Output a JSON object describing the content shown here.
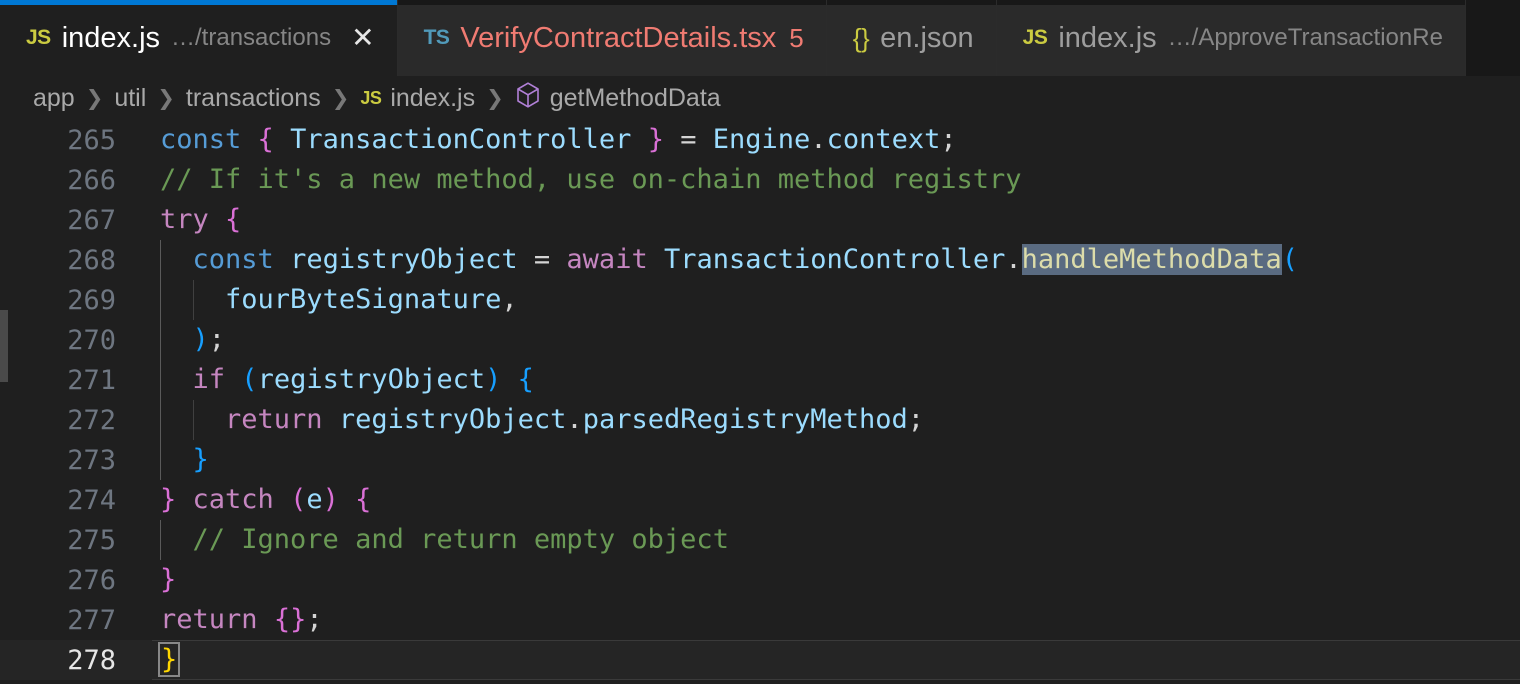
{
  "window": {
    "app": "Visual Studio Code",
    "accent_color": "#0078d4",
    "editor_background": "#1f1f1f",
    "tabbar_background": "#181818"
  },
  "tabbar": {
    "tabs": [
      {
        "icon": "js-file-icon",
        "icon_label": "JS",
        "name": "index.js",
        "path": "…/transactions",
        "badge": "",
        "close_label": "✕",
        "active": true,
        "has_errors": false
      },
      {
        "icon": "ts-file-icon",
        "icon_label": "TS",
        "name": "VerifyContractDetails.tsx",
        "path": "",
        "badge": "5",
        "close_label": "",
        "active": false,
        "has_errors": true
      },
      {
        "icon": "json-file-icon",
        "icon_label": "{}",
        "name": "en.json",
        "path": "",
        "badge": "",
        "close_label": "",
        "active": false,
        "has_errors": false
      },
      {
        "icon": "js-file-icon",
        "icon_label": "JS",
        "name": "index.js",
        "path": "…/ApproveTransactionRe",
        "badge": "",
        "close_label": "",
        "active": false,
        "has_errors": false
      }
    ]
  },
  "breadcrumb": {
    "separator": "❯",
    "items": [
      {
        "label": "app",
        "icon": ""
      },
      {
        "label": "util",
        "icon": ""
      },
      {
        "label": "transactions",
        "icon": ""
      },
      {
        "label": "index.js",
        "icon": "js-file-icon",
        "icon_label": "JS"
      },
      {
        "label": "getMethodData",
        "icon": "symbol-method-icon"
      }
    ]
  },
  "editor": {
    "language": "javascript",
    "active_line": 278,
    "selected_word": "handleMethodData",
    "first_visible_line": 265,
    "last_visible_line": 278,
    "lines": [
      {
        "n": "265",
        "text": "const { TransactionController } = Engine.context;"
      },
      {
        "n": "266",
        "text": "// If it's a new method, use on-chain method registry"
      },
      {
        "n": "267",
        "text": "try {"
      },
      {
        "n": "268",
        "text": "  const registryObject = await TransactionController.handleMethodData("
      },
      {
        "n": "269",
        "text": "    fourByteSignature,"
      },
      {
        "n": "270",
        "text": "  );"
      },
      {
        "n": "271",
        "text": "  if (registryObject) {"
      },
      {
        "n": "272",
        "text": "    return registryObject.parsedRegistryMethod;"
      },
      {
        "n": "273",
        "text": "  }"
      },
      {
        "n": "274",
        "text": "} catch (e) {"
      },
      {
        "n": "275",
        "text": "  // Ignore and return empty object"
      },
      {
        "n": "276",
        "text": "}"
      },
      {
        "n": "277",
        "text": "return {};"
      },
      {
        "n": "278",
        "text": "}"
      }
    ],
    "tokens": {
      "l265": [
        {
          "t": "const",
          "c": "kw2"
        },
        {
          "t": " ",
          "c": "pun"
        },
        {
          "t": "{",
          "c": "brc"
        },
        {
          "t": " ",
          "c": "pun"
        },
        {
          "t": "TransactionController",
          "c": "var"
        },
        {
          "t": " ",
          "c": "pun"
        },
        {
          "t": "}",
          "c": "brc"
        },
        {
          "t": " = ",
          "c": "pun"
        },
        {
          "t": "Engine",
          "c": "var"
        },
        {
          "t": ".",
          "c": "pun"
        },
        {
          "t": "context",
          "c": "var"
        },
        {
          "t": ";",
          "c": "pun"
        }
      ],
      "l266": [
        {
          "t": "// If it's a new method, use on-chain method registry",
          "c": "cmt"
        }
      ],
      "l267": [
        {
          "t": "try",
          "c": "kw"
        },
        {
          "t": " ",
          "c": "pun"
        },
        {
          "t": "{",
          "c": "brc"
        }
      ],
      "l268": [
        {
          "t": "  ",
          "c": "pun"
        },
        {
          "t": "const",
          "c": "kw2"
        },
        {
          "t": " ",
          "c": "pun"
        },
        {
          "t": "registryObject",
          "c": "var"
        },
        {
          "t": " = ",
          "c": "pun"
        },
        {
          "t": "await",
          "c": "kw"
        },
        {
          "t": " ",
          "c": "pun"
        },
        {
          "t": "TransactionController",
          "c": "var"
        },
        {
          "t": ".",
          "c": "pun"
        },
        {
          "t": "handleMethodData",
          "c": "fn sel"
        },
        {
          "t": "(",
          "c": "brc2"
        }
      ],
      "l269": [
        {
          "t": "    ",
          "c": "pun"
        },
        {
          "t": "fourByteSignature",
          "c": "var"
        },
        {
          "t": ",",
          "c": "pun"
        }
      ],
      "l270": [
        {
          "t": "  ",
          "c": "pun"
        },
        {
          "t": ")",
          "c": "brc2"
        },
        {
          "t": ";",
          "c": "pun"
        }
      ],
      "l271": [
        {
          "t": "  ",
          "c": "pun"
        },
        {
          "t": "if",
          "c": "kw"
        },
        {
          "t": " ",
          "c": "pun"
        },
        {
          "t": "(",
          "c": "brc2"
        },
        {
          "t": "registryObject",
          "c": "var"
        },
        {
          "t": ")",
          "c": "brc2"
        },
        {
          "t": " ",
          "c": "pun"
        },
        {
          "t": "{",
          "c": "brc2"
        }
      ],
      "l272": [
        {
          "t": "    ",
          "c": "pun"
        },
        {
          "t": "return",
          "c": "kw"
        },
        {
          "t": " ",
          "c": "pun"
        },
        {
          "t": "registryObject",
          "c": "var"
        },
        {
          "t": ".",
          "c": "pun"
        },
        {
          "t": "parsedRegistryMethod",
          "c": "var"
        },
        {
          "t": ";",
          "c": "pun"
        }
      ],
      "l273": [
        {
          "t": "  ",
          "c": "pun"
        },
        {
          "t": "}",
          "c": "brc2"
        }
      ],
      "l274": [
        {
          "t": "}",
          "c": "brc"
        },
        {
          "t": " ",
          "c": "pun"
        },
        {
          "t": "catch",
          "c": "kw"
        },
        {
          "t": " ",
          "c": "pun"
        },
        {
          "t": "(",
          "c": "brc"
        },
        {
          "t": "e",
          "c": "var"
        },
        {
          "t": ")",
          "c": "brc"
        },
        {
          "t": " ",
          "c": "pun"
        },
        {
          "t": "{",
          "c": "brc"
        }
      ],
      "l275": [
        {
          "t": "  ",
          "c": "pun"
        },
        {
          "t": "// Ignore and return empty object",
          "c": "cmt"
        }
      ],
      "l276": [
        {
          "t": "}",
          "c": "brc"
        }
      ],
      "l277": [
        {
          "t": "return",
          "c": "kw"
        },
        {
          "t": " ",
          "c": "pun"
        },
        {
          "t": "{",
          "c": "brc"
        },
        {
          "t": "}",
          "c": "brc"
        },
        {
          "t": ";",
          "c": "pun"
        }
      ],
      "l278": [
        {
          "t": "}",
          "c": "bmatch"
        }
      ]
    },
    "guides": {
      "l265": [],
      "l266": [],
      "l267": [],
      "l268": [
        "g1"
      ],
      "l269": [
        "g1",
        "g2"
      ],
      "l270": [
        "g1"
      ],
      "l271": [
        "g1"
      ],
      "l272": [
        "g1",
        "g2"
      ],
      "l273": [
        "g1"
      ],
      "l274": [],
      "l275": [
        "g1"
      ],
      "l276": [],
      "l277": [],
      "l278": []
    }
  }
}
